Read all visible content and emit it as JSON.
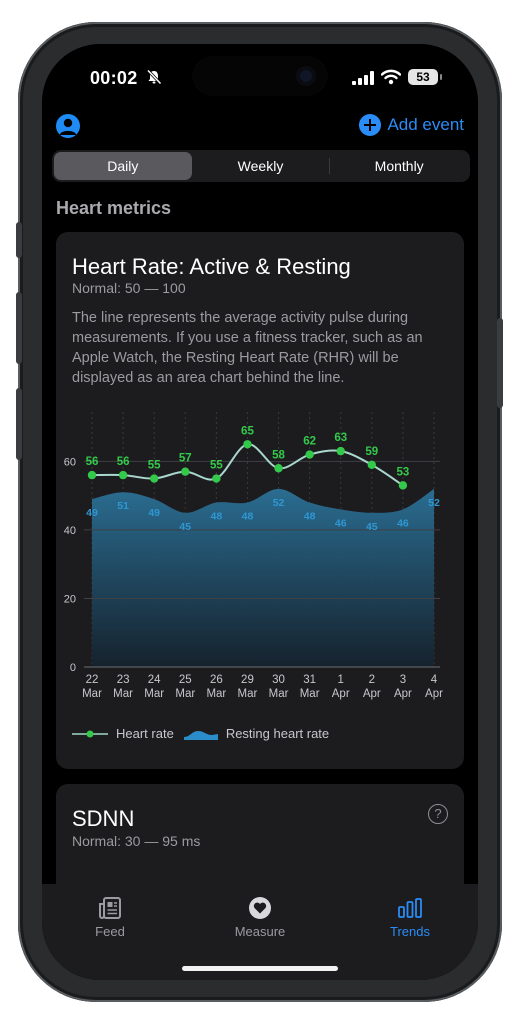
{
  "status_bar": {
    "time": "00:02",
    "battery": "53"
  },
  "topbar": {
    "add_event_label": "Add event"
  },
  "segments": {
    "daily": "Daily",
    "weekly": "Weekly",
    "monthly": "Monthly",
    "selected": "Daily"
  },
  "section_title": "Heart metrics",
  "heart_card": {
    "title": "Heart Rate: Active & Resting",
    "normal": "Normal: 50 — 100",
    "description": "The line represents the average activity pulse during measurements. If you use a fitness tracker, such as an Apple Watch, the Resting Heart Rate (RHR) will be displayed as an area chart behind the line.",
    "legend_heart": "Heart rate",
    "legend_resting": "Resting heart rate"
  },
  "chart_data": {
    "type": "line",
    "categories": [
      "22 Mar",
      "23 Mar",
      "24 Mar",
      "25 Mar",
      "26 Mar",
      "29 Mar",
      "30 Mar",
      "31 Mar",
      "1 Apr",
      "2 Apr",
      "3 Apr",
      "4 Apr"
    ],
    "day_labels": [
      "22",
      "23",
      "24",
      "25",
      "26",
      "29",
      "30",
      "31",
      "1",
      "2",
      "3",
      "4"
    ],
    "month_labels": [
      "Mar",
      "Mar",
      "Mar",
      "Mar",
      "Mar",
      "Mar",
      "Mar",
      "Mar",
      "Apr",
      "Apr",
      "Apr",
      "Apr"
    ],
    "series": [
      {
        "name": "Heart rate",
        "type": "line",
        "color": "#33c94a",
        "values": [
          56,
          56,
          55,
          57,
          55,
          65,
          58,
          62,
          63,
          59,
          53,
          null
        ]
      },
      {
        "name": "Resting heart rate",
        "type": "area",
        "color": "#2a6d8f",
        "values": [
          49,
          51,
          49,
          45,
          48,
          48,
          52,
          48,
          46,
          45,
          46,
          52
        ]
      }
    ],
    "y_ticks": [
      0,
      20,
      40,
      60
    ],
    "ylim": [
      0,
      75
    ],
    "grid": true
  },
  "sdnn_card": {
    "title": "SDNN",
    "normal": "Normal: 30 — 95 ms",
    "help": "?"
  },
  "tabs": {
    "feed": "Feed",
    "measure": "Measure",
    "trends": "Trends"
  },
  "colors": {
    "accent": "#2a8cf6",
    "heart_line": "#33c94a",
    "resting_label": "#2f97d2"
  }
}
